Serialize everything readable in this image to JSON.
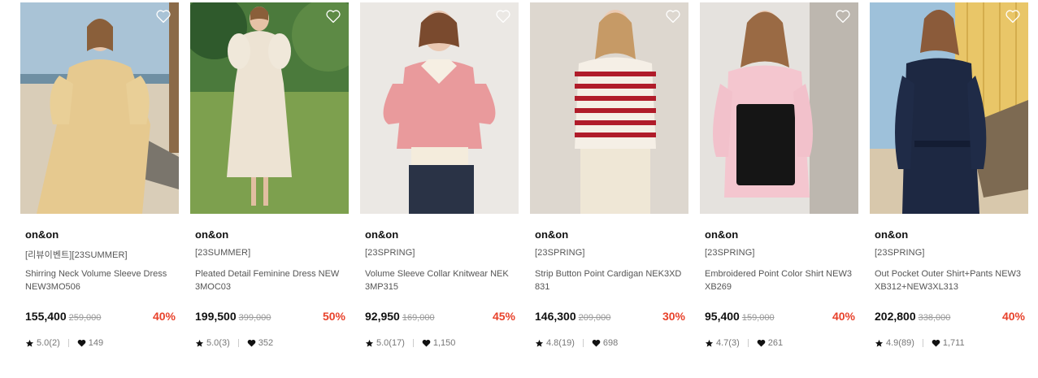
{
  "products": [
    {
      "brand": "on&on",
      "tag": "[리뷰이벤트][23SUMMER]",
      "name": "Shirring Neck Volume Sleeve Dress NEW3MO506",
      "price": "155,400",
      "original_price": "259,000",
      "discount": "40%",
      "rating": "5.0(2)",
      "likes": "149"
    },
    {
      "brand": "on&on",
      "tag": "[23SUMMER]",
      "name": "Pleated Detail Feminine Dress NEW3MOC03",
      "price": "199,500",
      "original_price": "399,000",
      "discount": "50%",
      "rating": "5.0(3)",
      "likes": "352"
    },
    {
      "brand": "on&on",
      "tag": "[23SPRING]",
      "name": "Volume Sleeve Collar Knitwear NEK3MP315",
      "price": "92,950",
      "original_price": "169,000",
      "discount": "45%",
      "rating": "5.0(17)",
      "likes": "1,150"
    },
    {
      "brand": "on&on",
      "tag": "[23SPRING]",
      "name": "Strip Button Point Cardigan NEK3XD831",
      "price": "146,300",
      "original_price": "209,000",
      "discount": "30%",
      "rating": "4.8(19)",
      "likes": "698"
    },
    {
      "brand": "on&on",
      "tag": "[23SPRING]",
      "name": "Embroidered Point Color Shirt NEW3XB269",
      "price": "95,400",
      "original_price": "159,000",
      "discount": "40%",
      "rating": "4.7(3)",
      "likes": "261"
    },
    {
      "brand": "on&on",
      "tag": "[23SPRING]",
      "name": "Out Pocket Outer Shirt+Pants NEW3XB312+NEW3XL313",
      "price": "202,800",
      "original_price": "338,000",
      "discount": "40%",
      "rating": "4.9(89)",
      "likes": "1,711"
    }
  ],
  "icons": {
    "wishlist": "heart-outline-icon",
    "rating": "star-icon",
    "likes": "heart-icon"
  },
  "colors": {
    "discount": "#e8422b"
  }
}
